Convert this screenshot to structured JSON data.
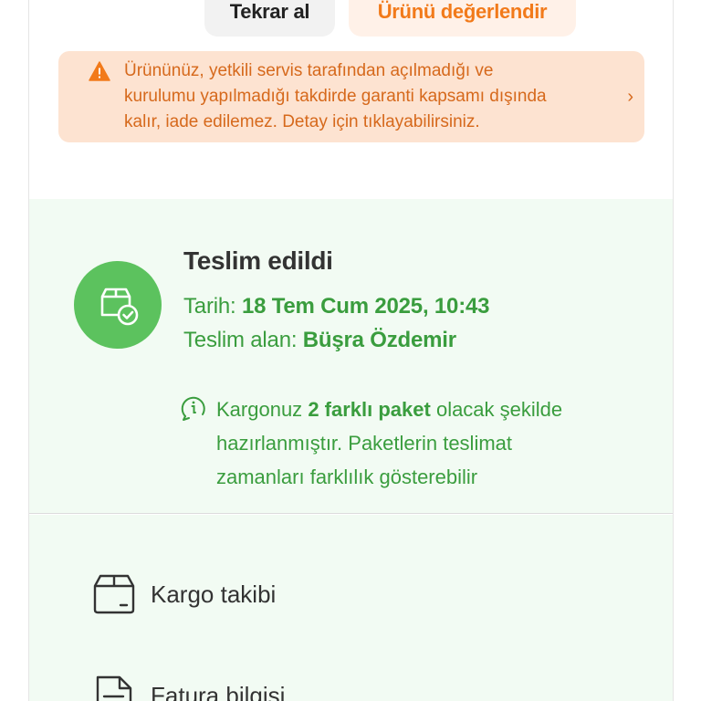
{
  "buttons": {
    "reorder_label": "Tekrar al",
    "review_label": "Ürünü değerlendir"
  },
  "warning": {
    "line1": "Ürününüz, yetkili servis tarafından açılmadığı ve",
    "line2": "kurulumu yapılmadığı takdirde garanti kapsamı dışında",
    "line3": "kalır, iade edilemez. Detay için tıklayabilirsiniz.",
    "icon": "warning-icon",
    "chevron": "›"
  },
  "delivery": {
    "status": "Teslim edildi",
    "date_label": "Tarih:",
    "date_value": "18 Tem Cum 2025, 10:43",
    "receiver_label": "Teslim alan:",
    "receiver_value": "Büşra Özdemir",
    "note_prefix": "Kargonuz",
    "note_bold": "2 farklı paket",
    "note_suffix1": "olacak şekilde",
    "note_line2": "hazırlanmıştır. Paketlerin teslimat",
    "note_line3": "zamanları farklılık gösterebilir"
  },
  "actions": {
    "cargo_label": "Kargo takibi",
    "invoice_label": "Fatura bilgisi"
  },
  "colors": {
    "accent_orange": "#f27a1a",
    "success_green": "#5cc25e",
    "text_green": "#3a9d3e",
    "panel_green": "#f2fbf3",
    "warning_bg": "#fde3d1"
  }
}
